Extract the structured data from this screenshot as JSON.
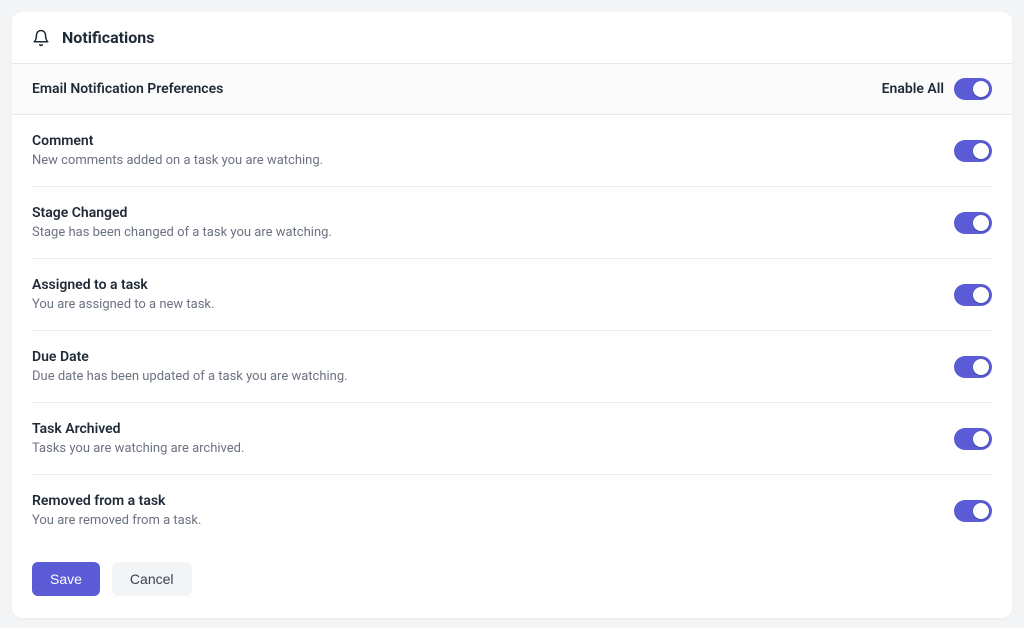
{
  "header": {
    "title": "Notifications"
  },
  "section": {
    "title": "Email Notification Preferences",
    "enable_all_label": "Enable All",
    "enable_all_on": true
  },
  "settings": [
    {
      "title": "Comment",
      "description": "New comments added on a task you are watching.",
      "on": true
    },
    {
      "title": "Stage Changed",
      "description": "Stage has been changed of a task you are watching.",
      "on": true
    },
    {
      "title": "Assigned to a task",
      "description": "You are assigned to a new task.",
      "on": true
    },
    {
      "title": "Due Date",
      "description": "Due date has been updated of a task you are watching.",
      "on": true
    },
    {
      "title": "Task Archived",
      "description": "Tasks you are watching are archived.",
      "on": true
    },
    {
      "title": "Removed from a task",
      "description": "You are removed from a task.",
      "on": true
    }
  ],
  "actions": {
    "save_label": "Save",
    "cancel_label": "Cancel"
  }
}
